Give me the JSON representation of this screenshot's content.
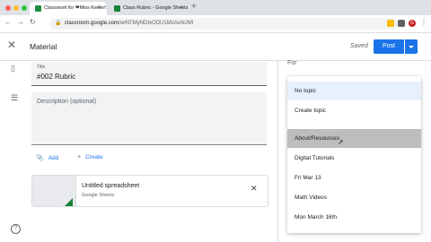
{
  "browser": {
    "tabs": [
      {
        "title": "Classwork for ❤Miss Keeler's",
        "fav_color": "#1e8e3e",
        "active": true
      },
      {
        "title": "Class Rubric - Google Sheets",
        "fav_color": "#188038",
        "active": false
      }
    ],
    "url_host": "classroom.google.com",
    "url_path": "/w/NTMyNDIxODU1MzAx/tc/Ml",
    "avatar_letter": "G"
  },
  "header": {
    "title": "Material",
    "saved": "Saved",
    "post": "Post"
  },
  "form": {
    "title_label": "Title",
    "title_value": "#002 Rubric",
    "description_placeholder": "Description (optional)",
    "add": "Add",
    "create": "Create"
  },
  "attachment": {
    "title": "Untitled spreadsheet",
    "type": "Google Sheets"
  },
  "topic": {
    "for_label": "For",
    "items": [
      "No topic",
      "Create topic",
      "About/Resources",
      "Digital Tutorials",
      "Fri Mar 13",
      "Math Videos",
      "Mon March 16th"
    ],
    "selected_index": 0,
    "hovered_index": 2
  },
  "colors": {
    "accent": "#1a73e8",
    "sheets_green": "#188038"
  }
}
